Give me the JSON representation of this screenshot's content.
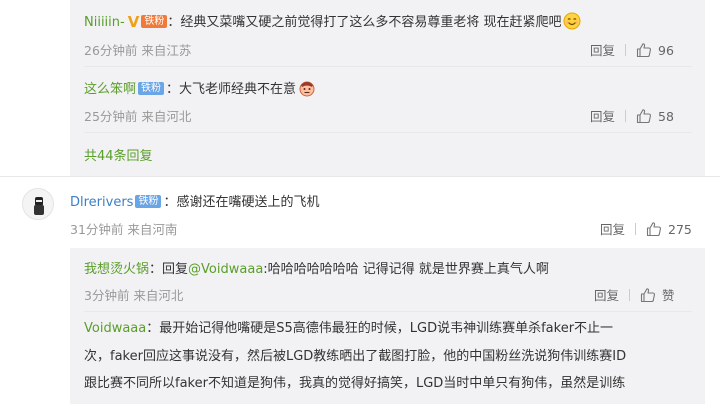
{
  "replies": [
    {
      "username": "Niiiiin-",
      "verified_mark": "V",
      "fan_badge": "铁粉",
      "text": "经典又菜嘴又硬之前觉得打了这么多不容易尊重老将 现在赶紧爬吧",
      "meta": "26分钟前 来自江苏",
      "reply_label": "回复",
      "likes": "96"
    },
    {
      "username": "这么笨啊",
      "fan_badge": "铁粉",
      "text": "大飞老师经典不在意",
      "meta": "25分钟前 来自河北",
      "reply_label": "回复",
      "likes": "58"
    }
  ],
  "more_replies": "共44条回复",
  "main_comment": {
    "username": "Dlrerivers",
    "fan_badge": "铁粉",
    "text": "感谢还在嘴硬送上的飞机",
    "meta": "31分钟前 来自河南",
    "reply_label": "回复",
    "likes": "275"
  },
  "nested_reply": {
    "username": "我想烫火锅",
    "reply_prefix": "回复",
    "mention": "@Voidwaaa",
    "text": ":哈哈哈哈哈哈哈 记得记得 就是世界赛上真气人啊",
    "meta": "3分钟前 来自河北",
    "reply_label": "回复",
    "like_label": "赞"
  },
  "quoted": {
    "username": "Voidwaaa",
    "line1": "最开始记得他嘴硬是S5高德伟最狂的时候，LGD说韦神训练赛单杀faker不止一",
    "line2": "次，faker回应这事说没有，然后被LGD教练晒出了截图打脸，他的中国粉丝洗说狗伟训练赛ID",
    "line3": "跟比赛不同所以faker不知道是狗伟，我真的觉得好搞笑，LGD当时中单只有狗伟，虽然是训练"
  },
  "colors": {
    "link_green": "#5a9e2a",
    "link_blue": "#3d7fc9",
    "panel_bg": "#f2f2f5",
    "badge_blue": "#6aa5e6"
  }
}
